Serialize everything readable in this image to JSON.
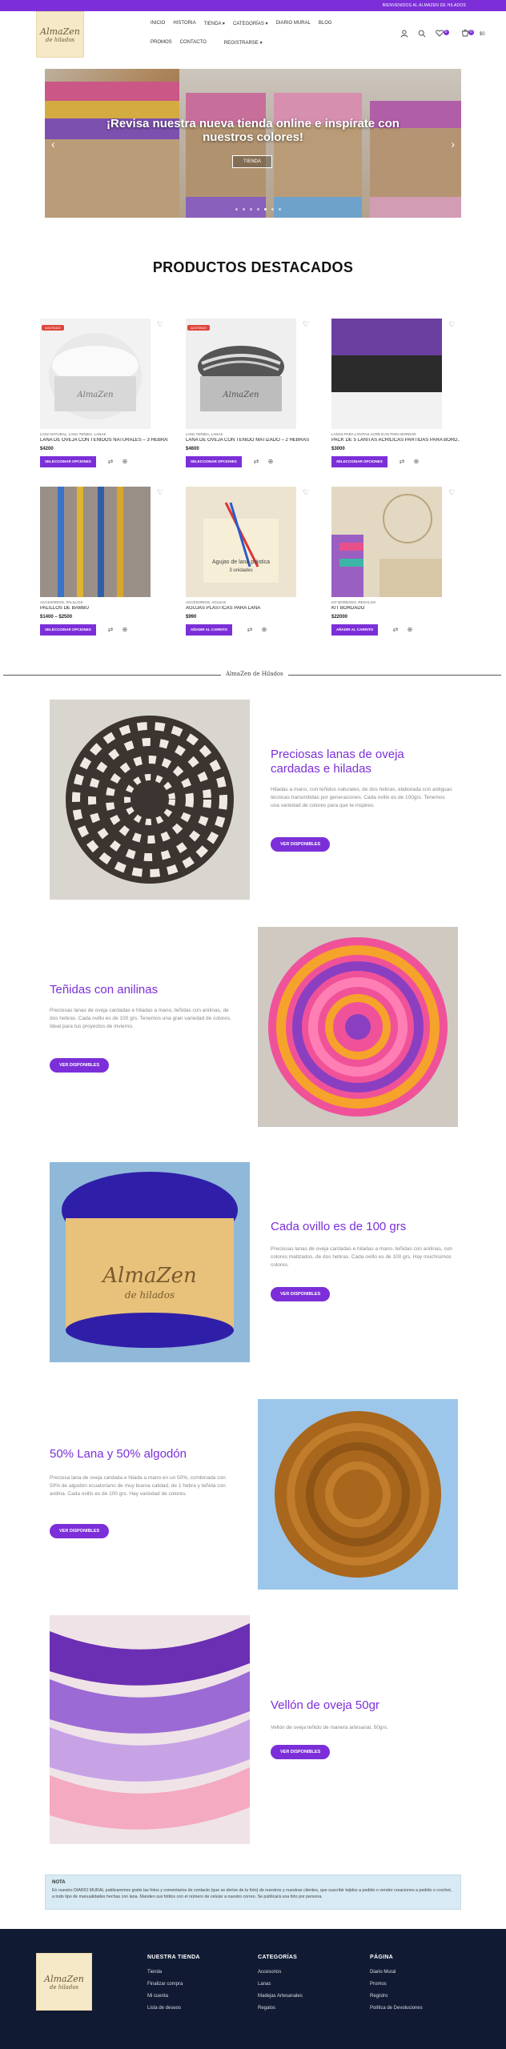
{
  "topbar": {
    "text": "BIENVENIDOS AL ALMAZEN DE HILADOS"
  },
  "brand": {
    "line1": "AlmaZen",
    "line2": "de hilados"
  },
  "nav": {
    "row1": [
      "INICIO",
      "HISTORIA",
      "TIENDA ▾",
      "CATEGORÍAS ▾",
      "DIARIO MURAL",
      "BLOG"
    ],
    "row2": [
      "PROMOS",
      "CONTACTO",
      "REGISTRARSE ▾"
    ]
  },
  "header_icons": {
    "cart_total": "$0",
    "wishlist_count": "0",
    "cart_count": "0"
  },
  "hero": {
    "headline": "¡Revisa nuestra nueva tienda online e inspírate con nuestros colores!",
    "button": "TIENDA",
    "prev": "‹",
    "next": "›"
  },
  "featured": {
    "title": "PRODUCTOS DESTACADOS"
  },
  "products": [
    {
      "tag": "AGOTADO",
      "category": "LANA NATURAL, LANA TEÑIDA, LANAS",
      "name": "LANA DE OVEJA CON TEÑIDOS NATURALES – 3 HEBRAS",
      "price": "$4200",
      "button": "SELECCIONAR OPCIONES"
    },
    {
      "tag": "AGOTADO",
      "category": "LANA TEÑIDA, LANAS",
      "name": "LANA DE OVEJA CON TEÑIDO MATIZADO – 2 HEBRAS",
      "price": "$4600",
      "button": "SELECCIONAR OPCIONES"
    },
    {
      "tag": "",
      "category": "LANAS PARA LANITAS ACRÍLICAS PARA BORDAR",
      "name": "PACK DE 5 LANITAS ACRÍLICAS PARTIDAS PARA BORD...",
      "price": "$3000",
      "button": "SELECCIONAR OPCIONES"
    },
    {
      "tag": "",
      "category": "ACCESORIOS, PALILLOS",
      "name": "PALILLOS DE BAMBÚ",
      "price": "$1400 – $2500",
      "button": "SELECCIONAR OPCIONES"
    },
    {
      "tag": "",
      "category": "ACCESORIOS, AGUJAS",
      "name": "AGUJAS PLÁSTICAS PARA LANA",
      "price": "$990",
      "button": "AÑADIR AL CARRITO"
    },
    {
      "tag": "",
      "category": "KIT BORDADO, REGALOS",
      "name": "KIT BORDADO",
      "price": "$22000",
      "button": "AÑADIR AL CARRITO"
    }
  ],
  "divider_label": "AlmaZen de Hilados",
  "features": [
    {
      "title": "Preciosas lanas de oveja cardadas e hiladas",
      "text": "Hiladas a mano, con teñidos naturales, de dos hebras, elaborada con antiguas técnicas transmitidas por generaciones. Cada ovillo es de 100grs. Tenemos una variedad de colores para que te inspires.",
      "button": "VER DISPONIBLES"
    },
    {
      "title": "Teñidas con anilinas",
      "text": "Preciosas lanas de oveja cardadas e hiladas a mano, teñidas con anilinas, de dos hebras. Cada ovillo es de 100 grs. Tenemos una gran variedad de colores. Ideal para tus proyectos de invierno.",
      "button": "VER DISPONIBLES"
    },
    {
      "title": "Cada ovillo es de 100 grs",
      "text": "Preciosas lanas de oveja cardadas e hiladas a mano, teñidas con anilinas, con colores matizados, de dos hebras. Cada ovillo es de 100 grs. Hay muchísimos colores.",
      "button": "VER DISPONIBLES"
    },
    {
      "title": "50% Lana y 50% algodón",
      "text": "Preciosa lana de oveja cardada e hilada a mano en un 50%, combinada con 50% de algodón ecuatoriano de muy buena calidad, de 1 hebra y teñida con anilina. Cada ovillo es de 100 grs. Hay variedad de colores.",
      "button": "VER DISPONIBLES"
    },
    {
      "title": "Vellón de oveja 50gr",
      "text": "Vellón de oveja teñido de manera artesanal, 50grs.",
      "button": "VER DISPONIBLES"
    }
  ],
  "note": {
    "title": "NOTA",
    "body": "En nuestro DIARIO MURAL publicaremos gratis las fotos y comentarios de contacto (que se derive de tu foto) de nuestros y nuestras clientes, que suscribir tejidos a pedido o vender creaciones a pedido o crochet, a todo tipo de manualidades hechas con lana. Manden sus fotitos con el número de celular a nuestro correo. Se publicará una foto por persona."
  },
  "footer": {
    "columns": [
      {
        "heading": "NUESTRA TIENDA",
        "items": [
          "Tienda",
          "Finalizar compra",
          "Mi cuenta",
          "Lista de deseos"
        ]
      },
      {
        "heading": "CATEGORÍAS",
        "items": [
          "Accesorios",
          "Lanas",
          "Madejas Artesanales",
          "Regalos"
        ]
      },
      {
        "heading": "PÁGINA",
        "items": [
          "Diario Mural",
          "Promos",
          "Registro",
          "Política de Devoluciones"
        ]
      }
    ]
  },
  "colors": {
    "accent": "#7c2fd8",
    "footer_bg": "#101b33",
    "note_bg": "#d8eaf3"
  }
}
